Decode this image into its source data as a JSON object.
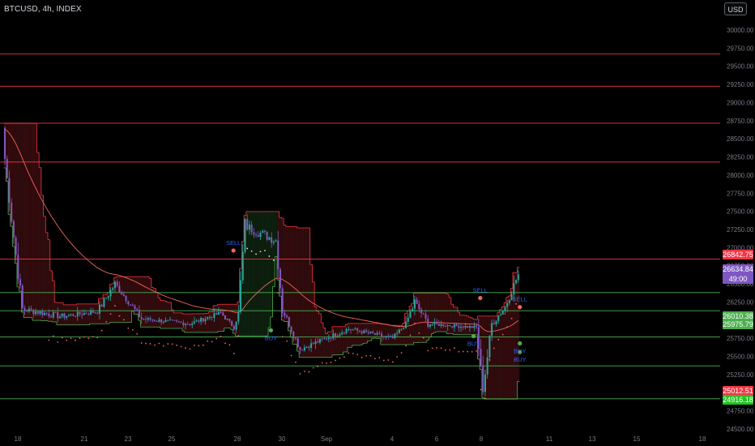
{
  "header": {
    "symbol_title": "BTCUSD, 4h, INDEX"
  },
  "toolbar": {
    "currency": "USD"
  },
  "colors": {
    "background": "#000000",
    "bull": "#26a69a",
    "bear": "#7e57c2",
    "resistance_line": "#f23645",
    "support_line": "#4caf50",
    "moving_average": "#f0645a",
    "signal_sell": "#f0645a",
    "signal_buy": "#4caf50",
    "signal_text": "#2962ff",
    "current_price_tag": "#7e57c2",
    "axis_text": "#787b86"
  },
  "price_axis": {
    "labels": [
      "30000.00",
      "29750.00",
      "29500.00",
      "29250.00",
      "29000.00",
      "28750.00",
      "28500.00",
      "28250.00",
      "28000.00",
      "27750.00",
      "27500.00",
      "27250.00",
      "27000.00",
      "26750.00",
      "26500.00",
      "26250.00",
      "26000.00",
      "25750.00",
      "25500.00",
      "25250.00",
      "25000.00",
      "24750.00",
      "24500.00"
    ]
  },
  "time_axis": {
    "labels": [
      "18",
      "21",
      "23",
      "25",
      "28",
      "30",
      "Sep",
      "4",
      "6",
      "8",
      "11",
      "13",
      "15",
      "18"
    ]
  },
  "chart_data": {
    "type": "candlestick",
    "symbol": "BTCUSD",
    "interval": "4h",
    "ylim": [
      24450,
      30100
    ],
    "horizontal_levels": [
      {
        "price": 29672,
        "color": "#f23645"
      },
      {
        "price": 29225,
        "color": "#f23645"
      },
      {
        "price": 28715,
        "color": "#f23645"
      },
      {
        "price": 28180,
        "color": "#f23645"
      },
      {
        "price": 26842.75,
        "color": "#f23645"
      },
      {
        "price": 26380,
        "color": "#4caf50"
      },
      {
        "price": 26130,
        "color": "#4caf50"
      },
      {
        "price": 25770,
        "color": "#4caf50"
      },
      {
        "price": 25370,
        "color": "#4caf50"
      },
      {
        "price": 24916.18,
        "color": "#4caf50"
      }
    ],
    "price_tags": [
      {
        "value": "26842.75",
        "color": "#f23645"
      },
      {
        "value": "26634.84",
        "sub": "49:00",
        "color": "#7e57c2"
      },
      {
        "value": "26010.38",
        "color": "#4caf50"
      },
      {
        "value": "25975.79",
        "color": "#4caf50"
      },
      {
        "value": "25012.51",
        "color": "#f23645"
      },
      {
        "value": "24916.18",
        "color": "#22c322"
      }
    ],
    "signals": [
      {
        "label": "SELL",
        "price": 26960,
        "color": "#f0645a"
      },
      {
        "label": "BUY",
        "price": 25860,
        "color": "#4caf50"
      },
      {
        "label": "SELL",
        "price": 26305,
        "color": "#f0645a"
      },
      {
        "label": "BUY",
        "price": 25780,
        "color": "#4caf50"
      },
      {
        "label": "SELL",
        "price": 26180,
        "color": "#f0645a"
      },
      {
        "label": "BUY",
        "price": 25560,
        "color": "#4caf50"
      },
      {
        "label": "BUY",
        "price": 25680,
        "color": "#4caf50"
      }
    ],
    "segments": [
      {
        "count": 4,
        "start": 28500,
        "end": 27400,
        "noise": 140
      },
      {
        "count": 5,
        "start": 27400,
        "end": 26150,
        "noise": 200
      },
      {
        "count": 18,
        "start": 26150,
        "end": 26050,
        "noise": 90
      },
      {
        "count": 16,
        "start": 26050,
        "end": 26120,
        "noise": 70
      },
      {
        "count": 8,
        "start": 26120,
        "end": 26500,
        "noise": 110
      },
      {
        "count": 12,
        "start": 26500,
        "end": 26020,
        "noise": 90
      },
      {
        "count": 22,
        "start": 26020,
        "end": 25950,
        "noise": 60
      },
      {
        "count": 14,
        "start": 25950,
        "end": 26100,
        "noise": 60
      },
      {
        "count": 6,
        "start": 26100,
        "end": 25900,
        "noise": 60
      },
      {
        "count": 2,
        "start": 25900,
        "end": 26100,
        "noise": 60
      },
      {
        "count": 3,
        "start": 26100,
        "end": 27300,
        "noise": 250
      },
      {
        "count": 14,
        "start": 27300,
        "end": 27100,
        "noise": 140
      },
      {
        "count": 3,
        "start": 27100,
        "end": 26150,
        "noise": 180
      },
      {
        "count": 8,
        "start": 26150,
        "end": 25600,
        "noise": 100
      },
      {
        "count": 22,
        "start": 25600,
        "end": 25880,
        "noise": 70
      },
      {
        "count": 20,
        "start": 25880,
        "end": 25750,
        "noise": 60
      },
      {
        "count": 6,
        "start": 25750,
        "end": 25950,
        "noise": 60
      },
      {
        "count": 4,
        "start": 25950,
        "end": 26250,
        "noise": 140
      },
      {
        "count": 6,
        "start": 26250,
        "end": 25950,
        "noise": 90
      },
      {
        "count": 22,
        "start": 25950,
        "end": 25900,
        "noise": 50
      },
      {
        "count": 3,
        "start": 25900,
        "end": 25050,
        "noise": 120
      },
      {
        "count": 4,
        "start": 25050,
        "end": 25950,
        "noise": 150
      },
      {
        "count": 6,
        "start": 25950,
        "end": 26180,
        "noise": 110
      },
      {
        "count": 6,
        "start": 26180,
        "end": 26634.84,
        "noise": 120
      }
    ]
  }
}
